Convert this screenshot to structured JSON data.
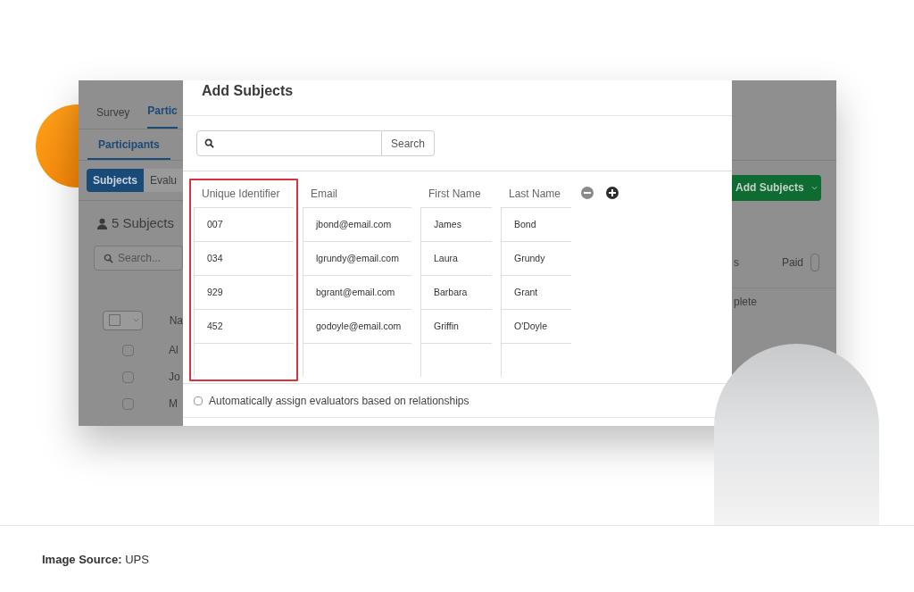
{
  "background_app": {
    "tabs": [
      {
        "label": "Survey",
        "selected": false
      },
      {
        "label": "Partic",
        "selected": true
      }
    ],
    "subtabs": [
      {
        "label": "Participants",
        "selected": true
      }
    ],
    "segments": [
      {
        "label": "Subjects",
        "selected": true
      },
      {
        "label": "Evalu",
        "selected": false
      }
    ],
    "count": "5 Subjects",
    "search_placeholder": "Search...",
    "column_fragment": "Na",
    "rows": [
      {
        "name_fragment": "Al",
        "checked": false
      },
      {
        "name_fragment": "Jo",
        "checked": false
      },
      {
        "name_fragment": "M",
        "checked": false
      }
    ],
    "add_button": "Add Subjects",
    "right_columns": [
      "s",
      "Paid"
    ],
    "status_fragment": "plete"
  },
  "dialog": {
    "title": "Add Subjects",
    "search_button": "Search",
    "columns": [
      {
        "label": "Unique Identifier",
        "highlighted": true
      },
      {
        "label": "Email",
        "highlighted": false
      },
      {
        "label": "First Name",
        "highlighted": false
      },
      {
        "label": "Last Name",
        "highlighted": false
      }
    ],
    "rows": [
      [
        "007",
        "jbond@email.com",
        "James",
        "Bond"
      ],
      [
        "034",
        "lgrundy@email.com",
        "Laura",
        "Grundy"
      ],
      [
        "929",
        "bgrant@email.com",
        "Barbara",
        "Grant"
      ],
      [
        "452",
        "godoyle@email.com",
        "Griffin",
        "O'Doyle"
      ]
    ],
    "checkbox": {
      "label": "Automatically assign evaluators based on relationships",
      "checked": false
    }
  },
  "footer": {
    "text": "**Image Source:** UPS"
  }
}
